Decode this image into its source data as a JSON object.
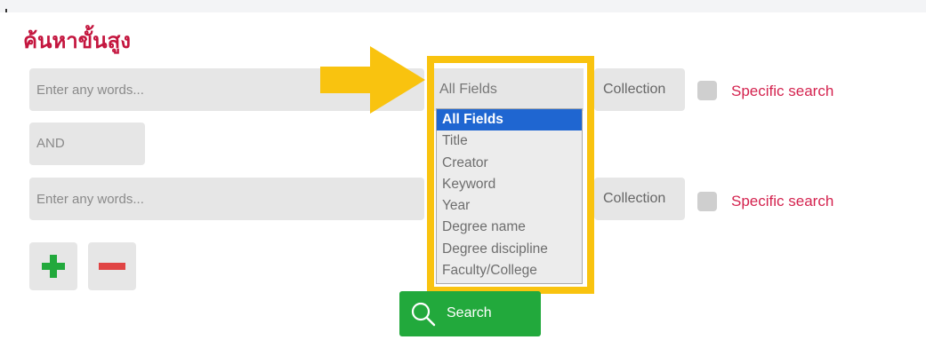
{
  "title": "ค้นหาขั้นสูง",
  "rows": [
    {
      "placeholder": "Enter any words...",
      "field_value": "All Fields",
      "collection_label": "Collection",
      "specific_label": "Specific search"
    },
    {
      "placeholder": "Enter any words...",
      "collection_label": "Collection",
      "specific_label": "Specific search"
    }
  ],
  "operator": "AND",
  "dropdown": {
    "options": [
      "All Fields",
      "Title",
      "Creator",
      "Keyword",
      "Year",
      "Degree name",
      "Degree discipline",
      "Faculty/College"
    ],
    "selected": "All Fields"
  },
  "search_label": "Search",
  "colors": {
    "accent": "#c4163f",
    "highlight": "#f9c30f",
    "search_button": "#22a93c",
    "plus": "#22a93c",
    "minus": "#e04444",
    "selected_option": "#1f66d1"
  },
  "icons": [
    "arrow-icon",
    "plus-icon",
    "minus-icon",
    "search-icon"
  ]
}
